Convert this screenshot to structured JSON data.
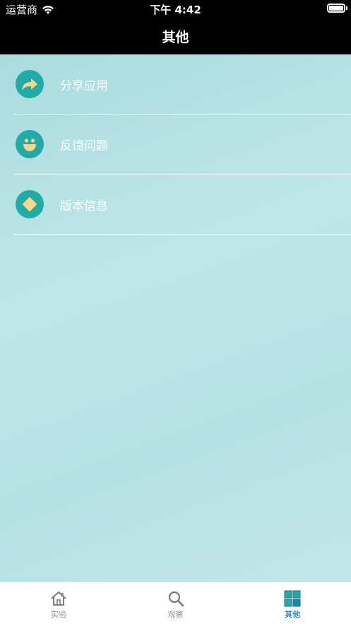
{
  "status_bar": {
    "carrier": "运营商",
    "time": "下午 4:42"
  },
  "nav": {
    "title": "其他"
  },
  "menu": {
    "items": [
      {
        "label": "分享应用",
        "icon": "share-arrow-icon"
      },
      {
        "label": "反馈问题",
        "icon": "smiley-face-icon"
      },
      {
        "label": "版本信息",
        "icon": "diamond-icon"
      }
    ]
  },
  "tabs": [
    {
      "label": "实验",
      "icon": "home-icon",
      "active": false
    },
    {
      "label": "观察",
      "icon": "magnifier-icon",
      "active": false
    },
    {
      "label": "其他",
      "icon": "grid-icon",
      "active": true
    }
  ],
  "colors": {
    "icon_circle": "#22aaa6",
    "icon_accent": "#f7d889",
    "active_tab": "#1e88e5",
    "content_bg": "#b8e2e4"
  }
}
